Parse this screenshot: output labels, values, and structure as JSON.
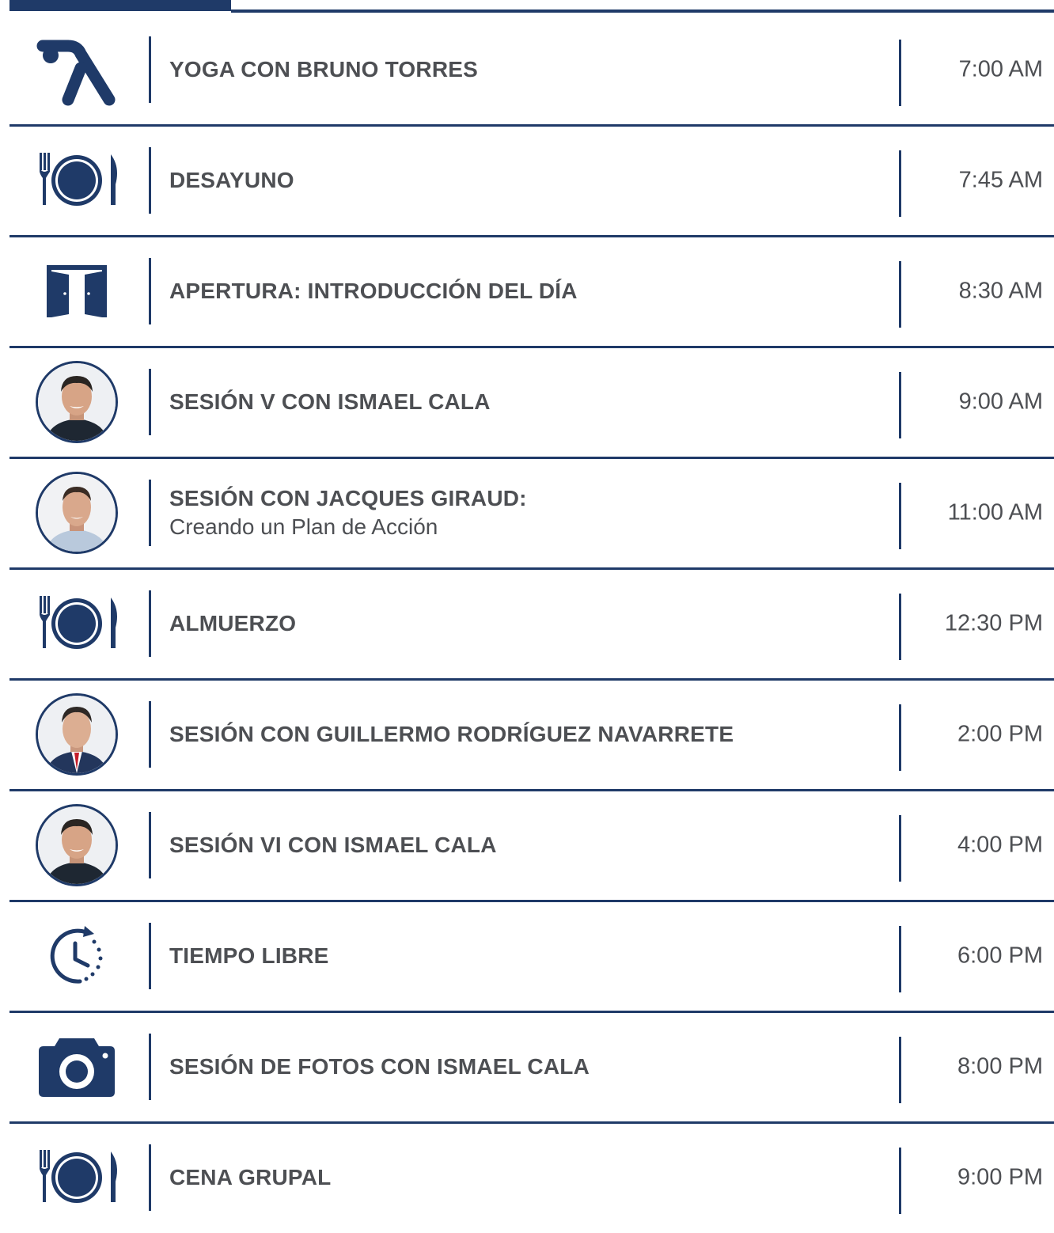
{
  "colors": {
    "navy": "#1f3a68",
    "text": "#4d4f53"
  },
  "schedule": [
    {
      "icon": "yoga-icon",
      "title": "YOGA CON BRUNO TORRES",
      "subtitle": "",
      "time": "7:00 AM"
    },
    {
      "icon": "dining-plate-icon",
      "title": "DESAYUNO",
      "subtitle": "",
      "time": "7:45 AM"
    },
    {
      "icon": "open-door-icon",
      "title": "APERTURA: INTRODUCCIÓN DEL DÍA",
      "subtitle": "",
      "time": "8:30 AM"
    },
    {
      "icon": "speaker-avatar-ismael-cala",
      "title": "SESIÓN V CON ISMAEL CALA",
      "subtitle": "",
      "time": "9:00 AM"
    },
    {
      "icon": "speaker-avatar-jacques-giraud",
      "title": "SESIÓN CON JACQUES GIRAUD:",
      "subtitle": "Creando un Plan de Acción",
      "time": "11:00 AM"
    },
    {
      "icon": "dining-plate-icon",
      "title": "ALMUERZO",
      "subtitle": "",
      "time": "12:30 PM"
    },
    {
      "icon": "speaker-avatar-guillermo-rodriguez",
      "title": "SESIÓN CON GUILLERMO RODRÍGUEZ NAVARRETE",
      "subtitle": "",
      "time": "2:00 PM"
    },
    {
      "icon": "speaker-avatar-ismael-cala",
      "title": "SESIÓN VI CON ISMAEL CALA",
      "subtitle": "",
      "time": "4:00 PM"
    },
    {
      "icon": "clock-free-time-icon",
      "title": "TIEMPO LIBRE",
      "subtitle": "",
      "time": "6:00 PM"
    },
    {
      "icon": "camera-icon",
      "title": "SESIÓN DE FOTOS CON ISMAEL CALA",
      "subtitle": "",
      "time": "8:00 PM"
    },
    {
      "icon": "dining-plate-icon",
      "title": "CENA GRUPAL",
      "subtitle": "",
      "time": "9:00 PM"
    }
  ]
}
